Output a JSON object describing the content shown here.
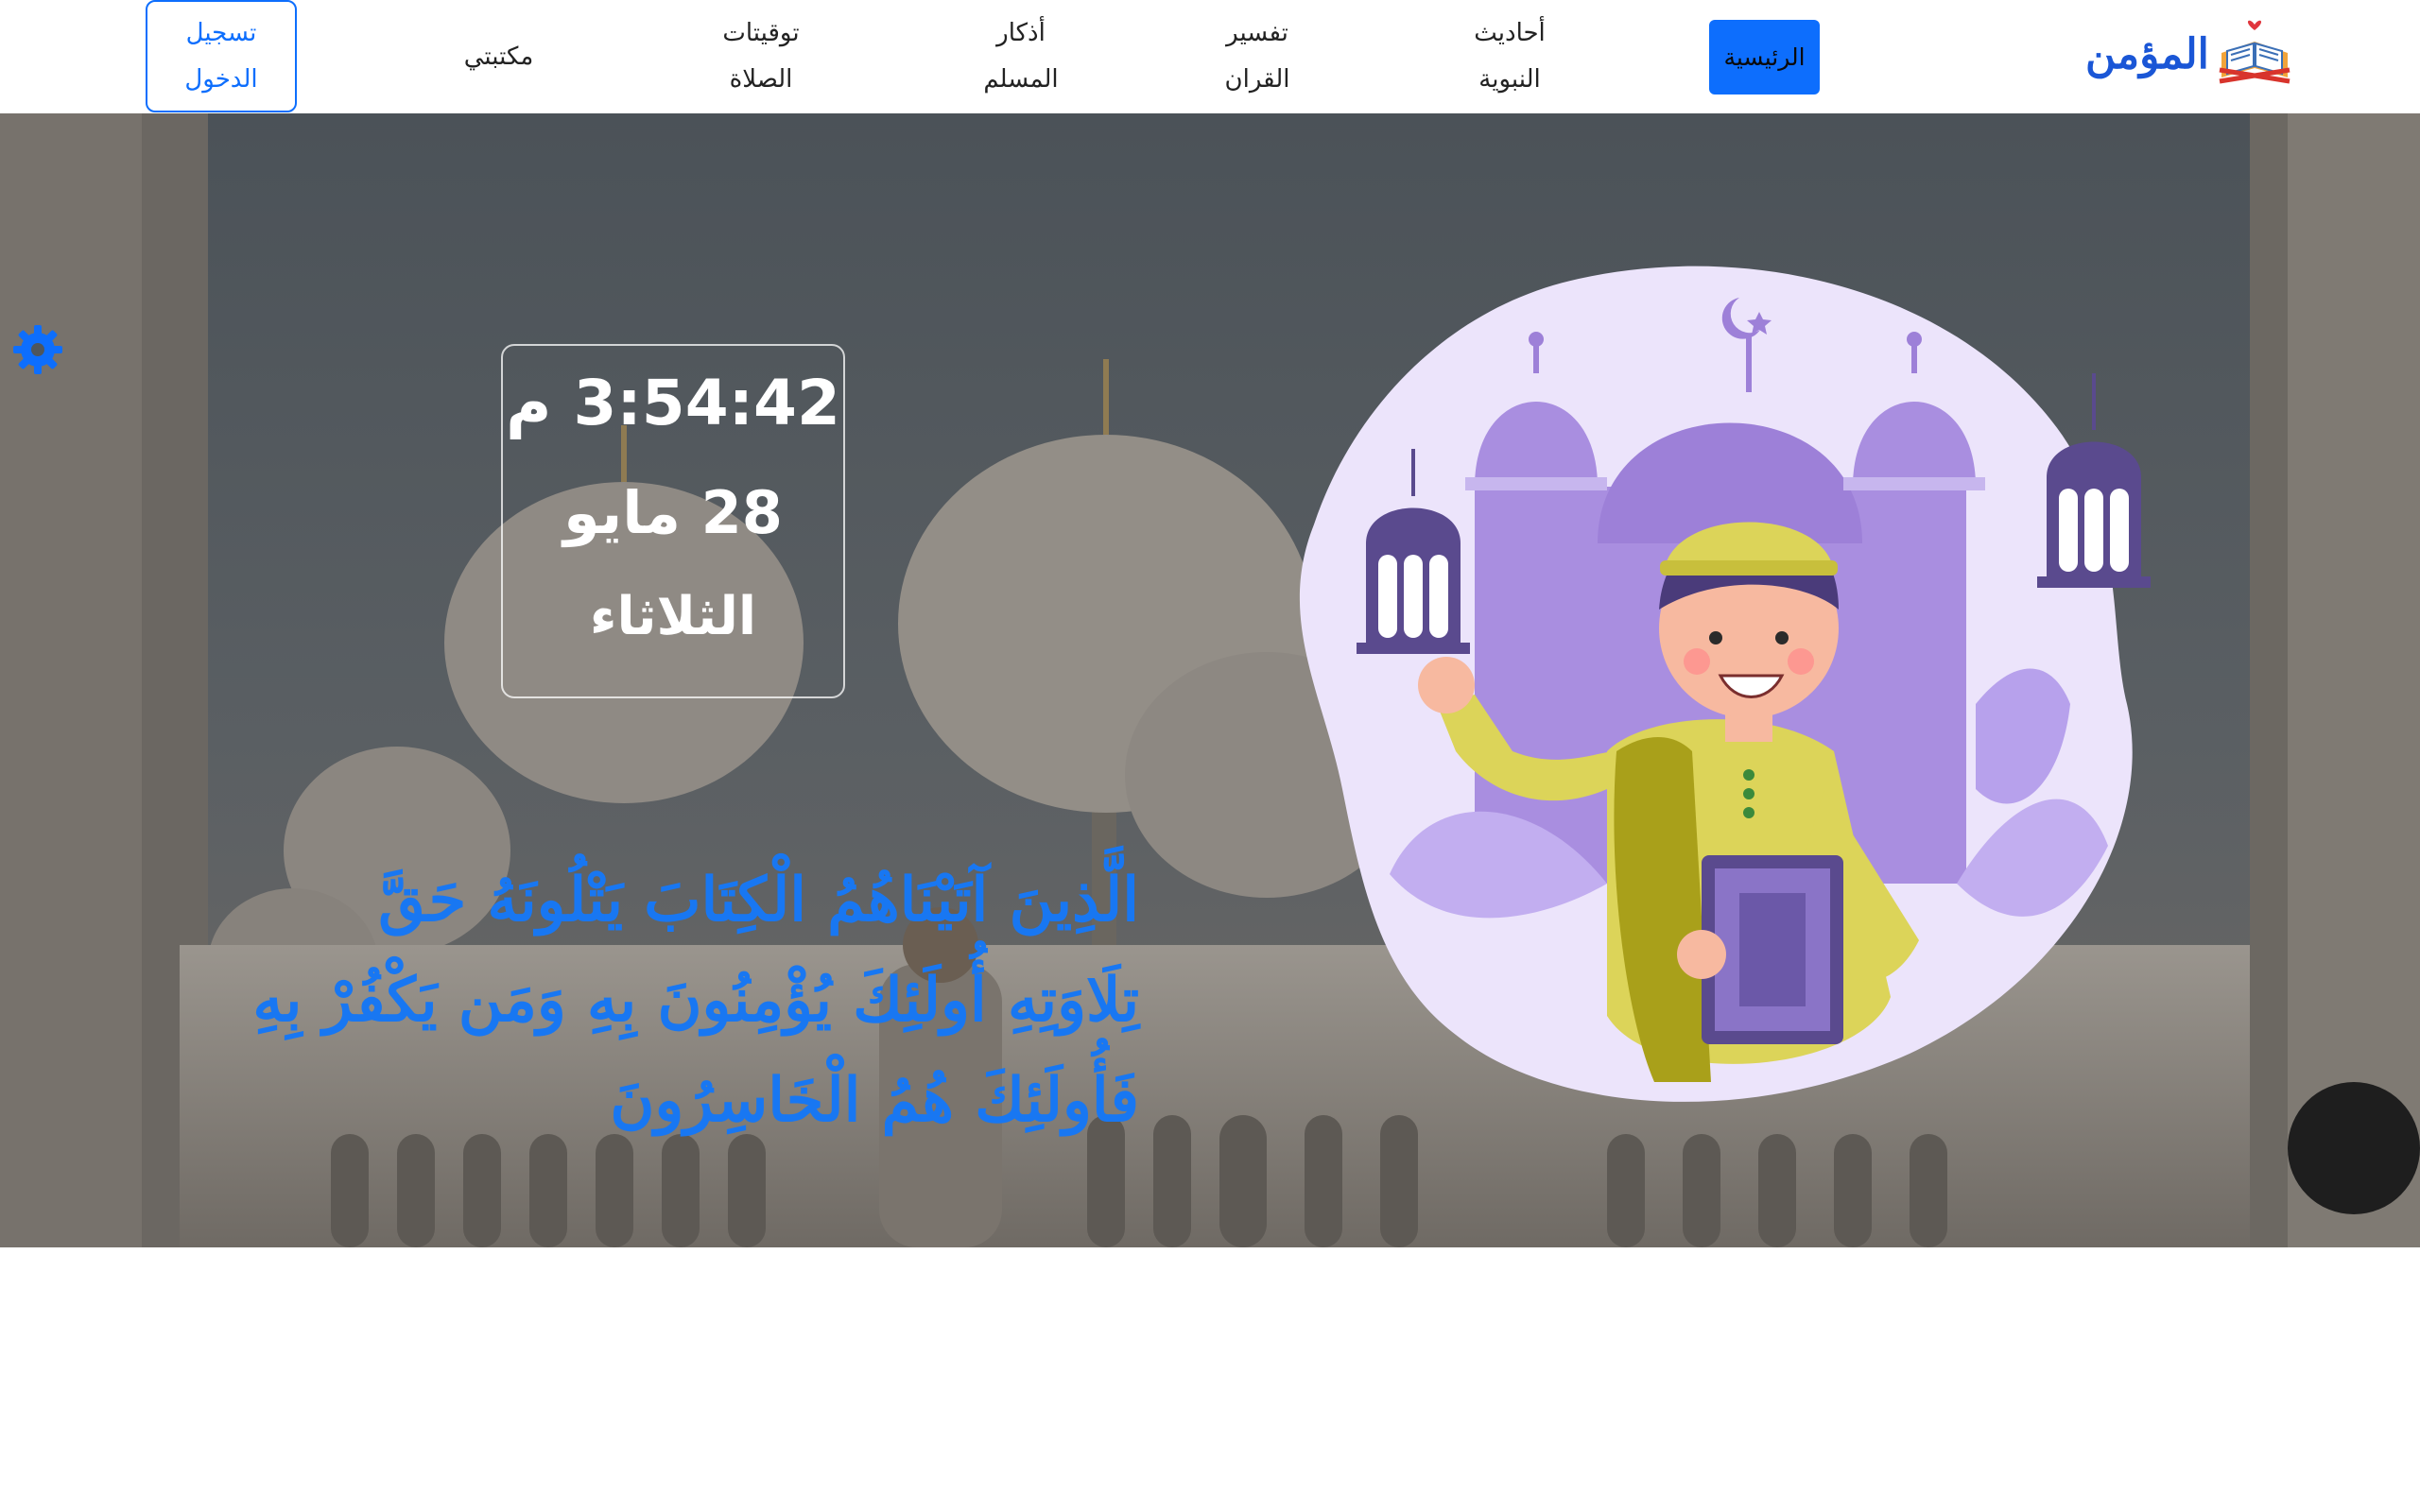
{
  "brand": {
    "name": "المؤمن",
    "colors": {
      "primary": "#0d6efd",
      "verse": "#1877f2",
      "logo": "#1a56d6"
    }
  },
  "nav": {
    "items": [
      {
        "label": "الرئيسية",
        "active": true
      },
      {
        "label": "أحاديث\nالنبوية"
      },
      {
        "label": "تفسير\nالقران"
      },
      {
        "label": "أذكار\nالمسلم"
      },
      {
        "label": "توقيتات\nالصلاة"
      },
      {
        "label": "مكتبتي"
      }
    ],
    "login": "تسجيل\nالدخول"
  },
  "clock": {
    "time": "3:54:42 م",
    "date": "28 مايو",
    "day": "الثلاثاء"
  },
  "verse": "الَّذِينَ آتَيْنَاهُمُ الْكِتَابَ يَتْلُونَهُ حَقَّ تِلَاوَتِهِ أُولَئِكَ يُؤْمِنُونَ بِهِ وَمَن يَكْفُرْ بِهِ فَأُولَئِكَ هُمُ الْخَاسِرُونَ",
  "icons": {
    "settings": "gear-icon",
    "logo": "book-logo-icon"
  }
}
